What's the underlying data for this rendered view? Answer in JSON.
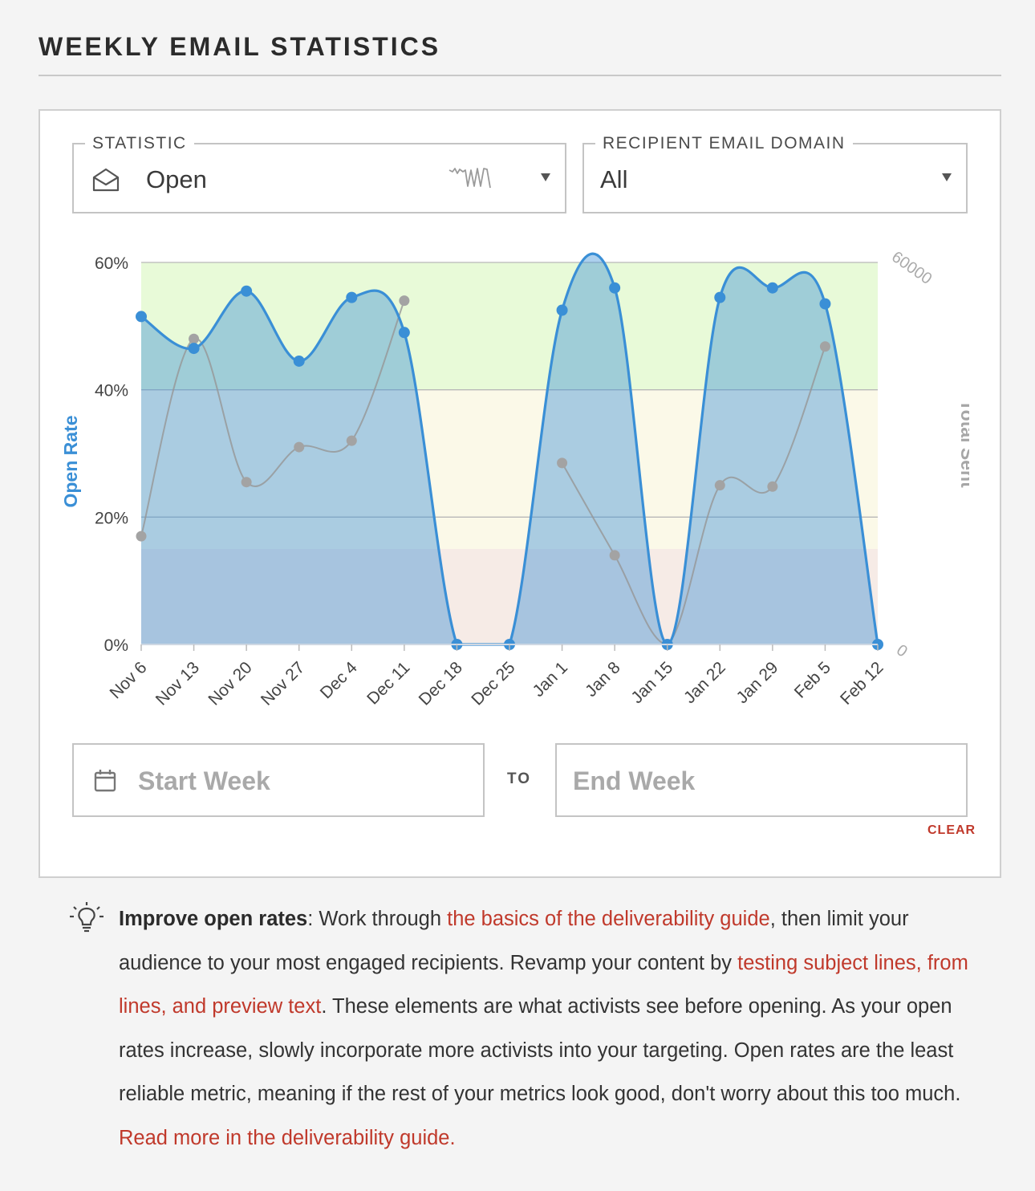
{
  "page": {
    "title": "WEEKLY EMAIL STATISTICS"
  },
  "filters": {
    "statistic": {
      "legend": "STATISTIC",
      "value": "Open",
      "icon": "envelope-open-icon",
      "indicator": "sparkline-icon"
    },
    "domain": {
      "legend": "RECIPIENT EMAIL DOMAIN",
      "value": "All"
    }
  },
  "chart_data": {
    "type": "area",
    "categories": [
      "Nov 6",
      "Nov 13",
      "Nov 20",
      "Nov 27",
      "Dec 4",
      "Dec 11",
      "Dec 18",
      "Dec 25",
      "Jan 1",
      "Jan 8",
      "Jan 15",
      "Jan 22",
      "Jan 29",
      "Feb 5",
      "Feb 12"
    ],
    "series": [
      {
        "name": "Open Rate",
        "axis": "left",
        "color": "#3a8fd6",
        "values": [
          51.5,
          46.5,
          55.5,
          44.5,
          54.5,
          49,
          0,
          0,
          52.5,
          56,
          0,
          54.5,
          56,
          53.5,
          0
        ]
      },
      {
        "name": "Total Sent",
        "axis": "right",
        "color": "#9a9a9a",
        "values": [
          17000,
          48000,
          25500,
          31000,
          32000,
          54000,
          null,
          null,
          28500,
          14000,
          0,
          25000,
          24800,
          46800,
          null
        ]
      }
    ],
    "ylabel": "Open Rate",
    "y2label": "Total Sent",
    "ylim": [
      0,
      60
    ],
    "y2lim": [
      0,
      60000
    ],
    "yticks": [
      "0%",
      "20%",
      "40%",
      "60%"
    ],
    "y2ticks": [
      "0",
      "60000"
    ],
    "bands": [
      {
        "from": 0,
        "to": 15,
        "color": "#f6ebe6"
      },
      {
        "from": 15,
        "to": 40,
        "color": "#fbf9e8"
      },
      {
        "from": 40,
        "to": 60,
        "color": "#e8fad8"
      }
    ],
    "grid": true
  },
  "date_range": {
    "start_placeholder": "Start Week",
    "to_label": "TO",
    "end_placeholder": "End Week",
    "clear_label": "CLEAR"
  },
  "tip": {
    "icon": "lightbulb-icon",
    "title": "Improve open rates",
    "t1": ": Work through ",
    "link1": "the basics of the deliverability guide",
    "t2": ", then limit your audience to your most engaged recipients. Revamp your content by ",
    "link2": "testing subject lines, from lines, and preview text",
    "t3": ". These elements are what activists see before opening. As your open rates increase, slowly incorporate more activists into your targeting. Open rates are the least reliable metric, meaning if the rest of your metrics look good, don't worry about this too much. ",
    "link3": "Read more in the deliverability guide."
  }
}
